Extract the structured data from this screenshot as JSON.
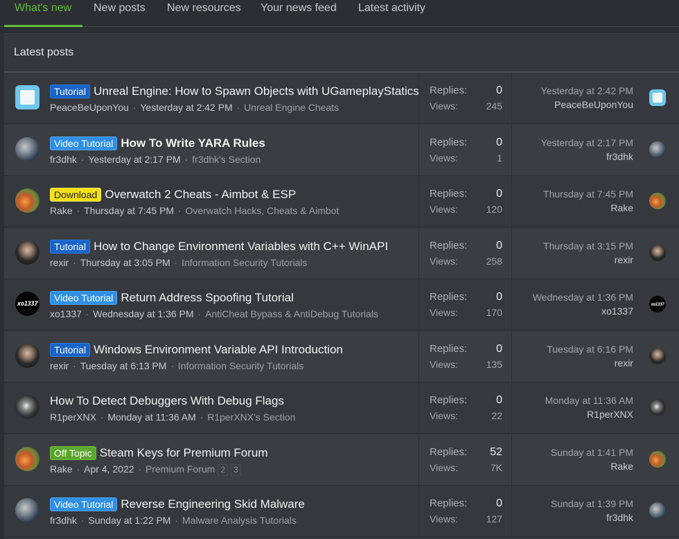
{
  "tabs": [
    {
      "label": "What's new",
      "active": true
    },
    {
      "label": "New posts",
      "active": false
    },
    {
      "label": "New resources",
      "active": false
    },
    {
      "label": "Your news feed",
      "active": false
    },
    {
      "label": "Latest activity",
      "active": false
    }
  ],
  "block": {
    "title": "Latest posts",
    "stats_labels": {
      "replies": "Replies:",
      "views": "Views:"
    }
  },
  "colors": {
    "accent": "#5fbf3c",
    "label_tutorial": "#1863c7",
    "label_video_tutorial": "#2f8fe6",
    "label_download": "#f5df17",
    "label_off_topic": "#5aa72b"
  },
  "threads": [
    {
      "prefix": "Tutorial",
      "title": "Unreal Engine: How to Spawn Objects with UGameplayStatics",
      "author": "PeaceBeUponYou",
      "date": "Yesterday at 2:42 PM",
      "forum": "Unreal Engine Cheats",
      "replies": "0",
      "views": "245",
      "last_date": "Yesterday at 2:42 PM",
      "last_user": "PeaceBeUponYou",
      "avatar_icon": "tile-avatar-icon"
    },
    {
      "prefix": "Video Tutorial",
      "title": "How To Write YARA Rules",
      "author": "fr3dhk",
      "date": "Yesterday at 2:17 PM",
      "forum": "fr3dhk's Section",
      "replies": "0",
      "views": "1",
      "last_date": "Yesterday at 2:17 PM",
      "last_user": "fr3dhk",
      "avatar_icon": "photo-avatar-icon"
    },
    {
      "prefix": "Download",
      "title": "Overwatch 2 Cheats - Aimbot & ESP",
      "author": "Rake",
      "date": "Thursday at 7:45 PM",
      "forum": "Overwatch Hacks, Cheats & Aimbot",
      "replies": "0",
      "views": "120",
      "last_date": "Thursday at 7:45 PM",
      "last_user": "Rake",
      "avatar_icon": "fire-avatar-icon"
    },
    {
      "prefix": "Tutorial",
      "title": "How to Change Environment Variables with C++ WinAPI",
      "author": "rexir",
      "date": "Thursday at 3:05 PM",
      "forum": "Information Security Tutorials",
      "replies": "0",
      "views": "258",
      "last_date": "Thursday at 3:15 PM",
      "last_user": "rexir",
      "avatar_icon": "person-avatar-icon"
    },
    {
      "prefix": "Video Tutorial",
      "title": "Return Address Spoofing Tutorial",
      "author": "xo1337",
      "date": "Wednesday at 1:36 PM",
      "forum": "AntiCheat Bypass & AntiDebug Tutorials",
      "replies": "0",
      "views": "170",
      "last_date": "Wednesday at 1:36 PM",
      "last_user": "xo1337",
      "avatar_text": "xo1337",
      "avatar_icon": "xo1337-avatar-icon"
    },
    {
      "prefix": "Tutorial",
      "title": "Windows Environment Variable API Introduction",
      "author": "rexir",
      "date": "Tuesday at 6:13 PM",
      "forum": "Information Security Tutorials",
      "replies": "0",
      "views": "135",
      "last_date": "Tuesday at 6:16 PM",
      "last_user": "rexir",
      "avatar_icon": "person-avatar-icon"
    },
    {
      "prefix": "",
      "title": "How To Detect Debuggers With Debug Flags",
      "author": "R1perXNX",
      "date": "Monday at 11:36 AM",
      "forum": "R1perXNX's Section",
      "replies": "0",
      "views": "22",
      "last_date": "Monday at 11:36 AM",
      "last_user": "R1perXNX",
      "avatar_icon": "moon-avatar-icon"
    },
    {
      "prefix": "Off Topic",
      "title": "Steam Keys for Premium Forum",
      "author": "Rake",
      "date": "Apr 4, 2022",
      "forum": "Premium Forum",
      "pages": [
        "2",
        "3"
      ],
      "replies": "52",
      "views": "7K",
      "last_date": "Sunday at 1:41 PM",
      "last_user": "Rake",
      "avatar_icon": "fire-avatar-icon"
    },
    {
      "prefix": "Video Tutorial",
      "title": "Reverse Engineering Skid Malware",
      "author": "fr3dhk",
      "date": "Sunday at 1:22 PM",
      "forum": "Malware Analysis Tutorials",
      "replies": "0",
      "views": "127",
      "last_date": "Sunday at 1:39 PM",
      "last_user": "fr3dhk",
      "avatar_icon": "photo-avatar-icon"
    }
  ]
}
